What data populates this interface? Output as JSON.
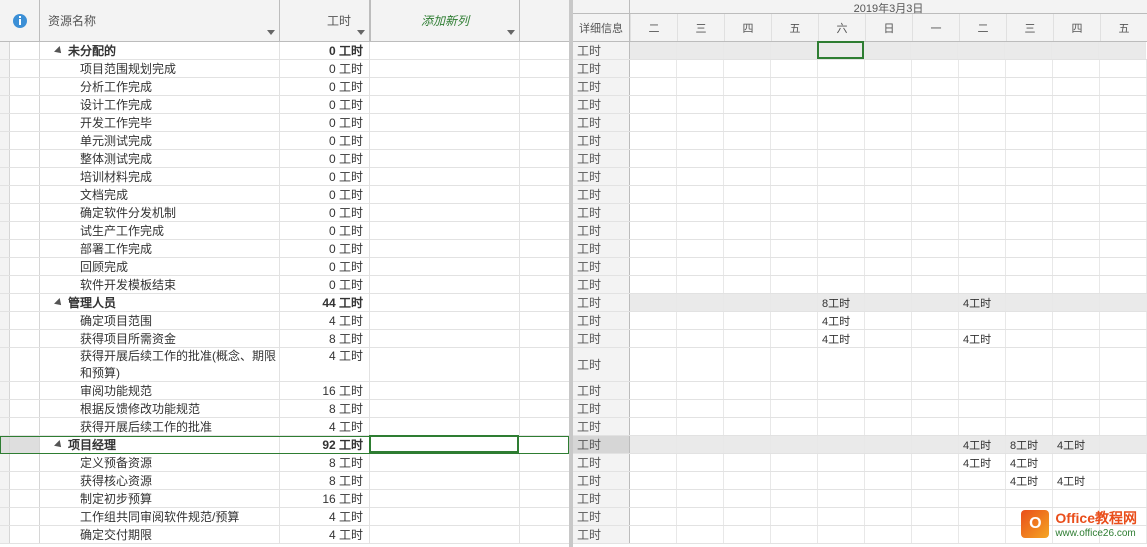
{
  "headers": {
    "resource_name": "资源名称",
    "work": "工时",
    "add_column": "添加新列",
    "details": "详细信息"
  },
  "date_label": "2019年3月3日",
  "days": [
    "二",
    "三",
    "四",
    "五",
    "六",
    "日",
    "一",
    "二",
    "三",
    "四",
    "五"
  ],
  "detail_row_label": "工时",
  "rows": [
    {
      "type": "summary",
      "name": "未分配的",
      "work": "0 工时",
      "cells": {}
    },
    {
      "type": "child",
      "name": "项目范围规划完成",
      "work": "0 工时",
      "cells": {}
    },
    {
      "type": "child",
      "name": "分析工作完成",
      "work": "0 工时",
      "cells": {}
    },
    {
      "type": "child",
      "name": "设计工作完成",
      "work": "0 工时",
      "cells": {}
    },
    {
      "type": "child",
      "name": "开发工作完毕",
      "work": "0 工时",
      "cells": {}
    },
    {
      "type": "child",
      "name": "单元测试完成",
      "work": "0 工时",
      "cells": {}
    },
    {
      "type": "child",
      "name": "整体测试完成",
      "work": "0 工时",
      "cells": {}
    },
    {
      "type": "child",
      "name": "培训材料完成",
      "work": "0 工时",
      "cells": {}
    },
    {
      "type": "child",
      "name": "文档完成",
      "work": "0 工时",
      "cells": {}
    },
    {
      "type": "child",
      "name": "确定软件分发机制",
      "work": "0 工时",
      "cells": {}
    },
    {
      "type": "child",
      "name": "试生产工作完成",
      "work": "0 工时",
      "cells": {}
    },
    {
      "type": "child",
      "name": "部署工作完成",
      "work": "0 工时",
      "cells": {}
    },
    {
      "type": "child",
      "name": "回顾完成",
      "work": "0 工时",
      "cells": {}
    },
    {
      "type": "child",
      "name": "软件开发模板结束",
      "work": "0 工时",
      "cells": {}
    },
    {
      "type": "summary",
      "name": "管理人员",
      "work": "44 工时",
      "cells": {
        "4": "8工时",
        "7": "4工时"
      }
    },
    {
      "type": "child",
      "name": "确定项目范围",
      "work": "4 工时",
      "cells": {
        "4": "4工时"
      }
    },
    {
      "type": "child",
      "name": "获得项目所需资金",
      "work": "8 工时",
      "cells": {
        "4": "4工时",
        "7": "4工时"
      }
    },
    {
      "type": "child",
      "name": "获得开展后续工作的批准(概念、期限和预算)",
      "work": "4 工时",
      "tall": true,
      "cells": {}
    },
    {
      "type": "child",
      "name": "审阅功能规范",
      "work": "16 工时",
      "cells": {}
    },
    {
      "type": "child",
      "name": "根据反馈修改功能规范",
      "work": "8 工时",
      "cells": {}
    },
    {
      "type": "child",
      "name": "获得开展后续工作的批准",
      "work": "4 工时",
      "cells": {}
    },
    {
      "type": "summary",
      "name": "项目经理",
      "work": "92 工时",
      "selected": true,
      "cells": {
        "7": "4工时",
        "8": "8工时",
        "9": "4工时"
      }
    },
    {
      "type": "child",
      "name": "定义预备资源",
      "work": "8 工时",
      "cells": {
        "7": "4工时",
        "8": "4工时"
      }
    },
    {
      "type": "child",
      "name": "获得核心资源",
      "work": "8 工时",
      "cells": {
        "8": "4工时",
        "9": "4工时"
      }
    },
    {
      "type": "child",
      "name": "制定初步预算",
      "work": "16 工时",
      "cells": {}
    },
    {
      "type": "child",
      "name": "工作组共同审阅软件规范/预算",
      "work": "4 工时",
      "cells": {}
    },
    {
      "type": "child",
      "name": "确定交付期限",
      "work": "4 工时",
      "cells": {}
    }
  ],
  "watermark": {
    "title": "Office教程网",
    "url": "www.office26.com"
  }
}
